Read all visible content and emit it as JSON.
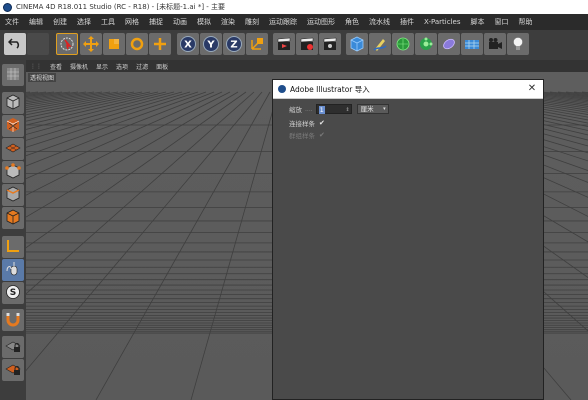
{
  "window": {
    "title": "CINEMA 4D R18.011 Studio (RC - R18) - [未标题-1.ai *] - 主要"
  },
  "menu": [
    "文件",
    "编辑",
    "创建",
    "选择",
    "工具",
    "网格",
    "捕捉",
    "动画",
    "模拟",
    "渲染",
    "雕刻",
    "运动跟踪",
    "运动图形",
    "角色",
    "流水线",
    "插件",
    "X-Particles",
    "脚本",
    "窗口",
    "帮助"
  ],
  "toolbar": {
    "undo": "undo-icon",
    "redo": "redo-icon",
    "select": "live-selection-icon",
    "move": "move-icon",
    "scale": "scale-icon",
    "rotate": "rotate-icon",
    "add": "add-icon",
    "x_axis": "X",
    "y_axis": "Y",
    "z_axis": "Z",
    "coords": "coordinate-system-icon",
    "accent": "#e0a020"
  },
  "viewport_menu": [
    "查看",
    "摄像机",
    "显示",
    "选项",
    "过滤",
    "面板"
  ],
  "viewport_label": "透视视图",
  "dialog": {
    "title": "Adobe Illustrator 导入",
    "scale_label": "缩放",
    "scale_dots": "....",
    "scale_value": "1",
    "unit_value": "厘米",
    "connect_splines_label": "连接样条",
    "connect_splines_checked": true,
    "group_splines_label": "群组样条",
    "group_splines_checked": true,
    "close": "✕"
  }
}
